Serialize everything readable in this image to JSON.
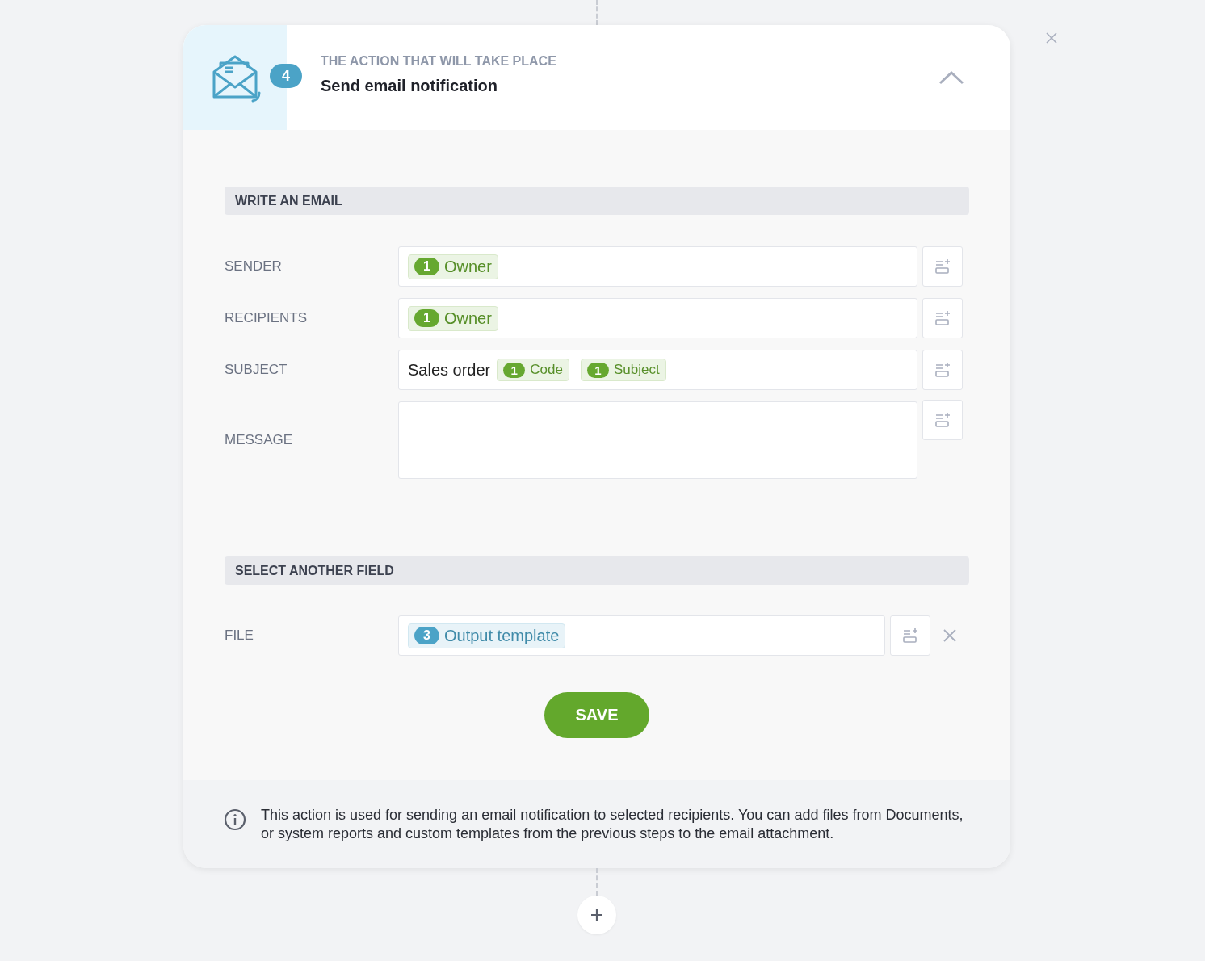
{
  "header": {
    "step": "4",
    "caption": "THE ACTION THAT WILL TAKE PLACE",
    "title": "Send email notification",
    "expanded": true
  },
  "sections": [
    {
      "title": "WRITE AN EMAIL",
      "rows": [
        {
          "label": "SENDER",
          "kind": "line",
          "removable": false,
          "parts": [
            {
              "kind": "token",
              "count": "1",
              "text": "Owner",
              "color": "#66a830"
            }
          ]
        },
        {
          "label": "RECIPIENTS",
          "kind": "line",
          "removable": false,
          "parts": [
            {
              "kind": "token",
              "count": "1",
              "text": "Owner",
              "color": "#66a830"
            }
          ]
        },
        {
          "label": "SUBJECT",
          "kind": "line",
          "removable": false,
          "parts": [
            {
              "kind": "text",
              "text": "Sales order"
            },
            {
              "kind": "token",
              "count": "1",
              "text": "Code",
              "color": "#66a830"
            },
            {
              "kind": "token",
              "count": "1",
              "text": "Subject",
              "color": "#66a830"
            }
          ]
        },
        {
          "label": "MESSAGE",
          "kind": "area",
          "removable": false,
          "parts": []
        }
      ]
    },
    {
      "title": "SELECT ANOTHER FIELD",
      "rows": [
        {
          "label": "FILE",
          "kind": "line",
          "removable": true,
          "parts": [
            {
              "kind": "token",
              "count": "3",
              "text": "Output template",
              "color": "#4ba3c7"
            }
          ]
        }
      ]
    }
  ],
  "save": "SAVE",
  "info": "This action is used for sending an email notification to selected recipients. You can add files from Documents, or system reports and custom templates from the previous steps to the email attachment."
}
